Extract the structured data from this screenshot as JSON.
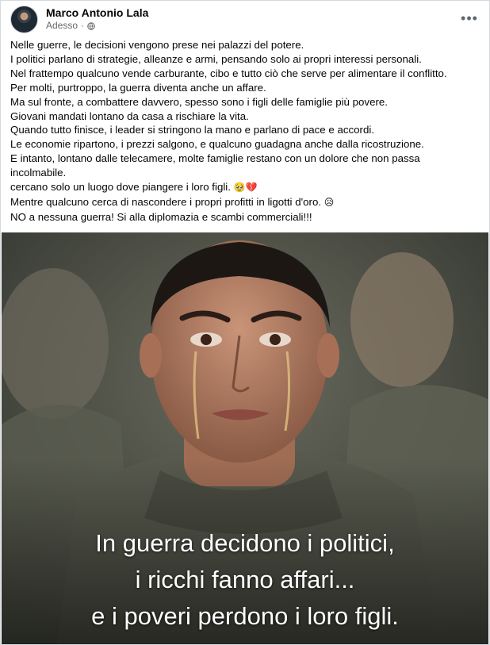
{
  "post": {
    "author": "Marco Antonio Lala",
    "timestamp": "Adesso",
    "separator": "·",
    "privacy_icon": "globe-icon",
    "more_icon": "ellipsis-icon",
    "more_label": "•••",
    "lines": [
      "Nelle guerre, le decisioni vengono prese nei palazzi del potere.",
      "I politici parlano di strategie, alleanze e armi, pensando solo ai propri interessi personali.",
      "Nel frattempo qualcuno vende carburante, cibo e tutto ciò che serve per alimentare il conflitto.",
      "Per molti, purtroppo, la guerra diventa anche un affare.",
      "Ma sul fronte, a combattere davvero, spesso sono i figli delle famiglie più povere.",
      "Giovani mandati lontano da casa a rischiare la vita.",
      "Quando tutto finisce, i leader si stringono la mano e parlano di pace e accordi.",
      "Le economie ripartono, i prezzi salgono, e qualcuno guadagna anche dalla ricostruzione.",
      "E intanto, lontano dalle telecamere, molte famiglie restano con un dolore che non passa incolmabile.",
      "cercano solo un luogo dove piangere i loro figli.",
      "Mentre qualcuno cerca di nascondere i propri profitti in ligotti d'oro.",
      "NO a nessuna guerra! Si alla diplomazia e scambi commerciali!!!"
    ],
    "emoji_1": "🥹💔",
    "emoji_2": "😥"
  },
  "image": {
    "caption_lines": [
      "In guerra decidono i politici,",
      "i ricchi fanno affari...",
      "e i poveri perdono i loro figli."
    ]
  },
  "colors": {
    "text": "#050505",
    "meta": "#65676b",
    "border": "#d6d9de"
  }
}
